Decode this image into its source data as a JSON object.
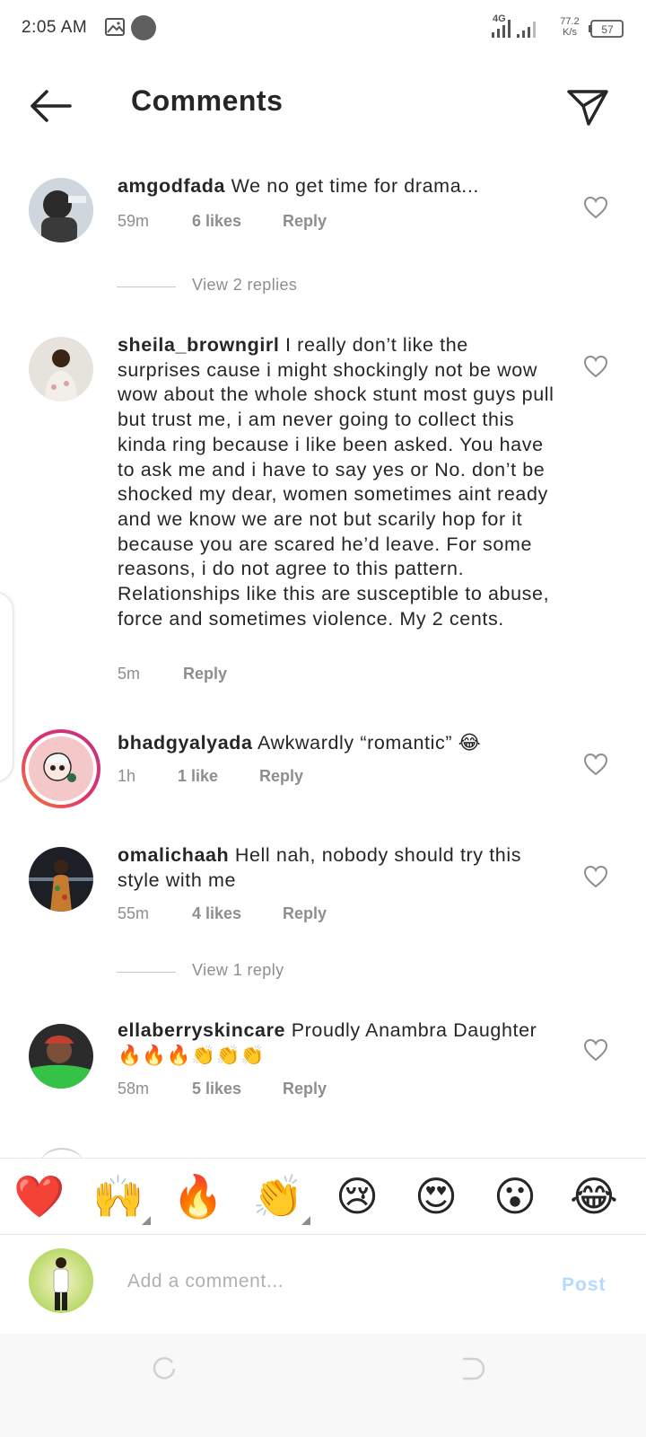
{
  "status_bar": {
    "time": "2:05 AM",
    "network": "4G",
    "speed_value": "77.2",
    "speed_unit": "K/s",
    "battery": "57"
  },
  "header": {
    "title": "Comments"
  },
  "comments": [
    {
      "username": "amgodfada",
      "text": "We no get time for drama...",
      "time": "59m",
      "likes": "6 likes",
      "reply_label": "Reply",
      "view_replies": "View 2 replies"
    },
    {
      "username": "sheila_browngirl",
      "text": "I really don’t like the surprises cause i might shockingly not be wow wow about the whole shock stunt most guys pull but trust me, i am never going to collect this kinda ring because i like been asked. You have to ask me and i have to say yes or No. don’t be shocked my dear, women sometimes aint ready and we know we are not but scarily hop for it because you are scared he’d leave. For some reasons, i do not agree to this pattern. Relationships like this are susceptible to abuse, force and sometimes violence. My 2 cents.",
      "time": "5m",
      "reply_label": "Reply"
    },
    {
      "username": "bhadgyalyada",
      "text": "Awkwardly “romantic” 😂",
      "time": "1h",
      "likes": "1 like",
      "reply_label": "Reply"
    },
    {
      "username": "omalichaah",
      "text": "Hell nah, nobody should try this style with me",
      "time": "55m",
      "likes": "4 likes",
      "reply_label": "Reply",
      "view_replies": "View 1 reply"
    },
    {
      "username": "ellaberryskincare",
      "text": "Proudly Anambra Daughter 🔥🔥🔥👏👏👏",
      "time": "58m",
      "likes": "5 likes",
      "reply_label": "Reply"
    }
  ],
  "emoji_bar": [
    "❤️",
    "🙌",
    "🔥",
    "👏",
    "😢",
    "😍",
    "😮",
    "😂"
  ],
  "composer": {
    "placeholder": "Add a comment...",
    "post_label": "Post"
  },
  "colors": {
    "text": "#262626",
    "muted": "#8e8e8e",
    "post_disabled": "#b3dbff",
    "story_ring_start": "#e1306c",
    "story_ring_end": "#f77737"
  }
}
